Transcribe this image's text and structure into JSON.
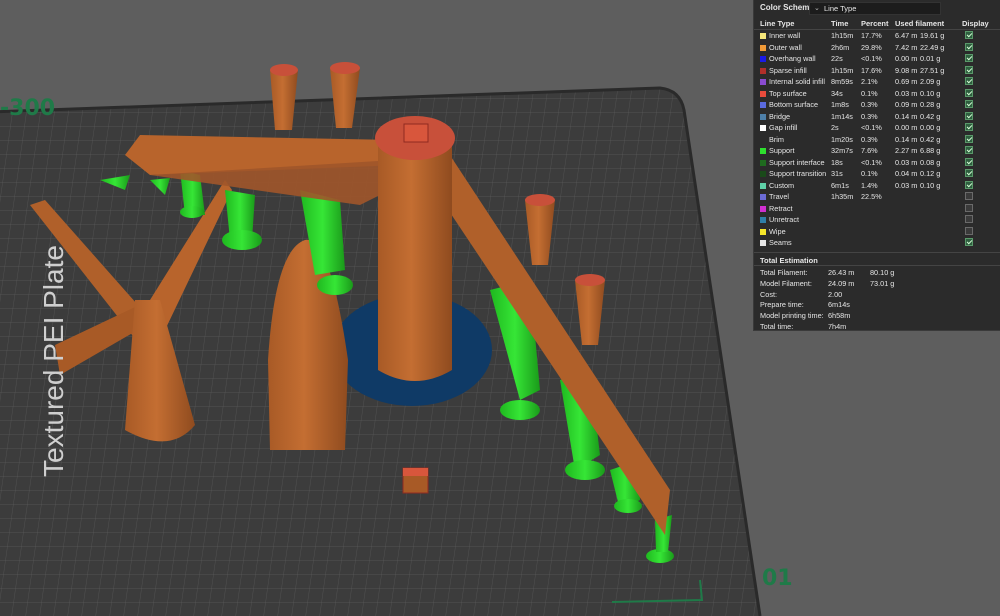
{
  "viewport": {
    "plate_name": "Textured PEI Plate",
    "plate_number": "01",
    "printer_tag": "-300"
  },
  "panel": {
    "color_scheme_label": "Color Scheme",
    "color_scheme_value": "Line Type",
    "headers": {
      "line_type": "Line Type",
      "time": "Time",
      "percent": "Percent",
      "used_filament": "Used filament",
      "display": "Display"
    },
    "rows": [
      {
        "name": "Inner wall",
        "color": "#f5e67a",
        "time": "1h15m",
        "percent": "17.7%",
        "len": "6.47 m",
        "weight": "19.61 g",
        "display": true
      },
      {
        "name": "Outer wall",
        "color": "#f09a37",
        "time": "2h6m",
        "percent": "29.8%",
        "len": "7.42 m",
        "weight": "22.49 g",
        "display": true
      },
      {
        "name": "Overhang wall",
        "color": "#1a1ae6",
        "time": "22s",
        "percent": "<0.1%",
        "len": "0.00 m",
        "weight": "0.01 g",
        "display": true
      },
      {
        "name": "Sparse infill",
        "color": "#b02f2a",
        "time": "1h15m",
        "percent": "17.6%",
        "len": "9.08 m",
        "weight": "27.51 g",
        "display": true
      },
      {
        "name": "Internal solid infill",
        "color": "#8a4bd1",
        "time": "8m59s",
        "percent": "2.1%",
        "len": "0.69 m",
        "weight": "2.09 g",
        "display": true
      },
      {
        "name": "Top surface",
        "color": "#e84b3c",
        "time": "34s",
        "percent": "0.1%",
        "len": "0.03 m",
        "weight": "0.10 g",
        "display": true
      },
      {
        "name": "Bottom surface",
        "color": "#5a6adf",
        "time": "1m8s",
        "percent": "0.3%",
        "len": "0.09 m",
        "weight": "0.28 g",
        "display": true
      },
      {
        "name": "Bridge",
        "color": "#4d7fa8",
        "time": "1m14s",
        "percent": "0.3%",
        "len": "0.14 m",
        "weight": "0.42 g",
        "display": true
      },
      {
        "name": "Gap infill",
        "color": "#ffffff",
        "time": "2s",
        "percent": "<0.1%",
        "len": "0.00 m",
        "weight": "0.00 g",
        "display": true
      },
      {
        "name": "Brim",
        "color": "#2b2b2b",
        "time": "1m20s",
        "percent": "0.3%",
        "len": "0.14 m",
        "weight": "0.42 g",
        "display": true
      },
      {
        "name": "Support",
        "color": "#2ee02e",
        "time": "32m7s",
        "percent": "7.6%",
        "len": "2.27 m",
        "weight": "6.88 g",
        "display": true
      },
      {
        "name": "Support interface",
        "color": "#1f6b1f",
        "time": "18s",
        "percent": "<0.1%",
        "len": "0.03 m",
        "weight": "0.08 g",
        "display": true
      },
      {
        "name": "Support transition",
        "color": "#1a4a1a",
        "time": "31s",
        "percent": "0.1%",
        "len": "0.04 m",
        "weight": "0.12 g",
        "display": true
      },
      {
        "name": "Custom",
        "color": "#5fd0a8",
        "time": "6m1s",
        "percent": "1.4%",
        "len": "0.03 m",
        "weight": "0.10 g",
        "display": true
      },
      {
        "name": "Travel",
        "color": "#6b6bd6",
        "time": "1h35m",
        "percent": "22.5%",
        "len": "",
        "weight": "",
        "display": false
      },
      {
        "name": "Retract",
        "color": "#d02fd0",
        "time": "",
        "percent": "",
        "len": "",
        "weight": "",
        "display": false
      },
      {
        "name": "Unretract",
        "color": "#2f7fa8",
        "time": "",
        "percent": "",
        "len": "",
        "weight": "",
        "display": false
      },
      {
        "name": "Wipe",
        "color": "#f5e62a",
        "time": "",
        "percent": "",
        "len": "",
        "weight": "",
        "display": false
      },
      {
        "name": "Seams",
        "color": "#e6e6e6",
        "time": "",
        "percent": "",
        "len": "",
        "weight": "",
        "display": true
      }
    ],
    "estimation_title": "Total Estimation",
    "estimation": [
      {
        "label": "Total Filament:",
        "v1": "26.43 m",
        "v2": "80.10 g"
      },
      {
        "label": "Model Filament:",
        "v1": "24.09 m",
        "v2": "73.01 g"
      },
      {
        "label": "Cost:",
        "v1": "2.00",
        "v2": ""
      },
      {
        "label": "Prepare time:",
        "v1": "6m14s",
        "v2": ""
      },
      {
        "label": "Model printing time:",
        "v1": "6h58m",
        "v2": ""
      },
      {
        "label": "Total time:",
        "v1": "7h4m",
        "v2": ""
      }
    ]
  }
}
